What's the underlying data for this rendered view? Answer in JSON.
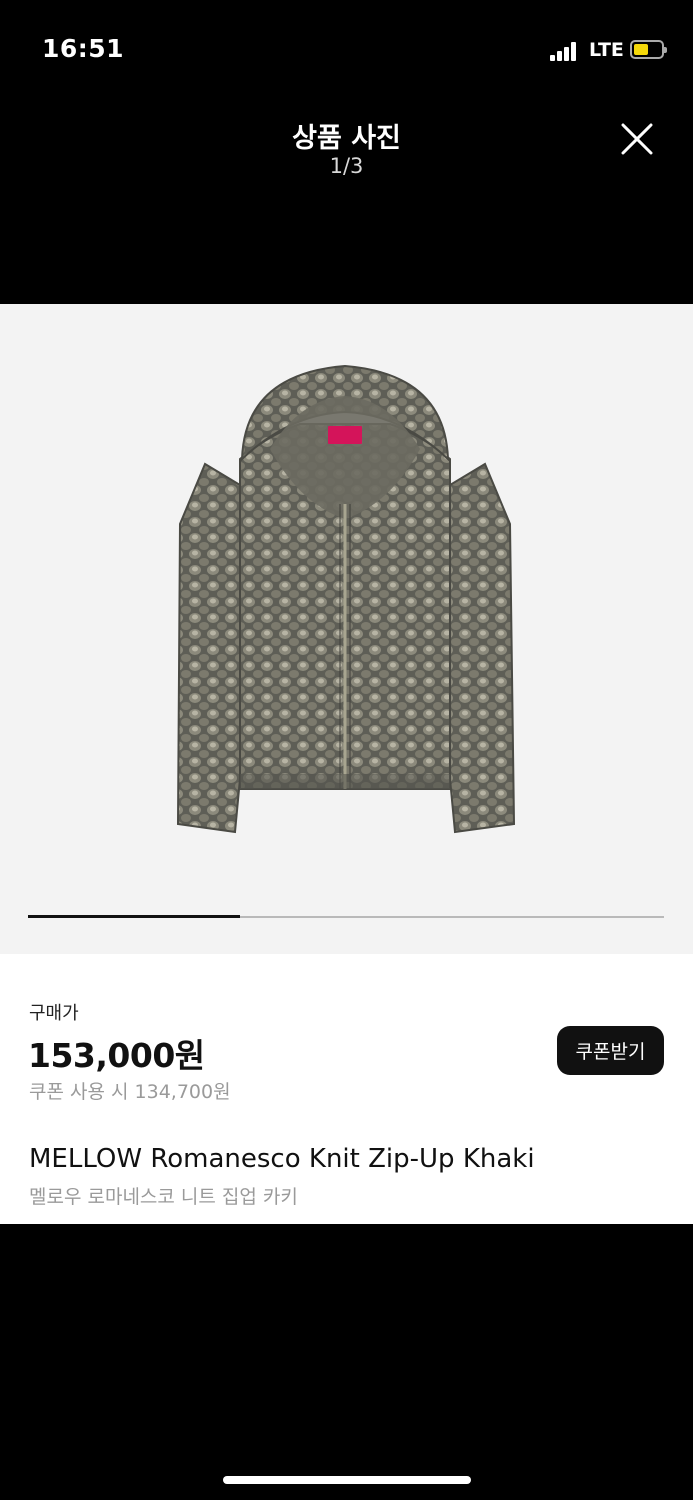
{
  "status_bar": {
    "time": "16:51",
    "network": "LTE",
    "signal_bars": 4,
    "battery_level": 0.55,
    "battery_color": "#f4d80a"
  },
  "viewer": {
    "title": "상품 사진",
    "counter": "1/3",
    "close_icon": "close-icon",
    "progress": 0.333
  },
  "product": {
    "price_label": "구매가",
    "price": "153,000원",
    "coupon_price": "쿠폰 사용 시 134,700원",
    "coupon_button": "쿠폰받기",
    "name": "MELLOW Romanesco Knit Zip-Up Khaki",
    "name_ko": "멜로우 로마네스코 니트 집업 카키"
  },
  "colors": {
    "background": "#000000",
    "photo_background": "#f3f3f3",
    "button": "#111111",
    "secondary_text": "#9a9a9a"
  }
}
